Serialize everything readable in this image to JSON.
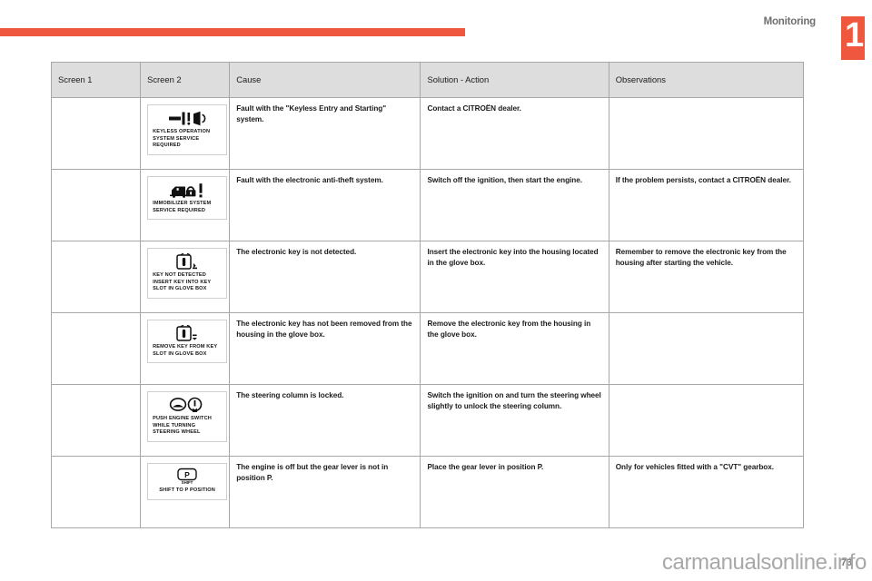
{
  "header": {
    "chapter_title": "Monitoring",
    "chapter_number": "1",
    "accent_color": "#F0573F"
  },
  "table": {
    "columns": [
      "Screen 1",
      "Screen 2",
      "Cause",
      "Solution - Action",
      "Observations"
    ],
    "rows": [
      {
        "screen1": "",
        "screen2_icon": "keyless-operation-icon",
        "screen2_text": "KEYLESS OPERATION\nSYSTEM SERVICE\nREQUIRED",
        "cause": "Fault with the \"Keyless Entry and Starting\" system.",
        "solution": "Contact a CITROËN dealer.",
        "observations": ""
      },
      {
        "screen1": "",
        "screen2_icon": "immobilizer-icon",
        "screen2_text": "IMMOBILIZER SYSTEM\nSERVICE REQUIRED",
        "cause": "Fault with the electronic anti-theft system.",
        "solution": "Switch off the ignition, then start the engine.",
        "observations": "If the problem persists, contact a CITROËN dealer."
      },
      {
        "screen1": "",
        "screen2_icon": "key-not-detected-icon",
        "screen2_text": "KEY NOT DETECTED\nINSERT KEY INTO KEY\nSLOT IN GLOVE BOX",
        "cause": "The electronic key is not detected.",
        "solution": "Insert the electronic key into the housing located in the glove box.",
        "observations": "Remember to remove the electronic key from the housing after starting the vehicle."
      },
      {
        "screen1": "",
        "screen2_icon": "remove-key-icon",
        "screen2_text": "REMOVE KEY FROM KEY\nSLOT IN GLOVE BOX",
        "cause": "The electronic key has not been removed from the housing in the glove box.",
        "solution": "Remove the electronic key from the housing in the glove box.",
        "observations": ""
      },
      {
        "screen1": "",
        "screen2_icon": "push-engine-switch-icon",
        "screen2_text": "PUSH ENGINE SWITCH\nWHILE TURNING\nSTEERING WHEEL",
        "cause": "The steering column is locked.",
        "solution": "Switch the ignition on and turn the steering wheel slightly to unlock the steering column.",
        "observations": ""
      },
      {
        "screen1": "",
        "screen2_icon": "shift-to-p-icon",
        "screen2_text": "SHIFT TO P POSITION",
        "cause": "The engine is off but the gear lever is not in position P.",
        "solution": "Place the gear lever in position P.",
        "observations": "Only for vehicles fitted with a \"CVT\" gearbox."
      }
    ]
  },
  "footer": {
    "watermark": "carmanualsonline.info",
    "page_number": "73"
  }
}
